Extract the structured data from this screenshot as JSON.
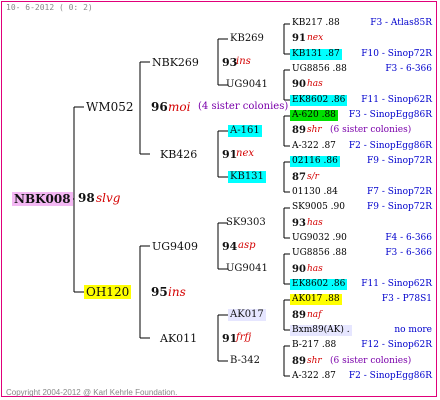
{
  "header": "10-  6-2012 (  0:  2)",
  "footer": "Copyright 2004-2012 @ Karl Kehrle Foundation.",
  "root": {
    "name": "NBK008",
    "num": "98",
    "tag": "slvg"
  },
  "g1": [
    {
      "name": "WM052",
      "num": "96",
      "tag": "moi",
      "note": "(4 sister colonies)"
    },
    {
      "name": "OH120",
      "num": "95",
      "tag": "ins"
    }
  ],
  "g2": [
    {
      "name": "NBK269",
      "num": "93",
      "tag": "ins"
    },
    {
      "name": "KB426",
      "num": "91",
      "tag": "nex"
    },
    {
      "name": "UG9409",
      "num": "94",
      "tag": "asp"
    },
    {
      "name": "AK011",
      "num": "91",
      "tag": "frfj"
    }
  ],
  "g3": [
    {
      "name": "KB269"
    },
    {
      "name": "UG9041"
    },
    {
      "name": "A-161"
    },
    {
      "name": "KB131"
    },
    {
      "name": "SK9303"
    },
    {
      "name": "UG9041"
    },
    {
      "name": "AK017"
    },
    {
      "name": "B-342"
    }
  ],
  "g4": [
    {
      "name": "KB217 .88",
      "right": "F3 - Atlas85R"
    },
    {
      "num": "91",
      "tag": "nex"
    },
    {
      "name": "KB131 .87",
      "right": "F10 - Sinop72R"
    },
    {
      "name": "UG8856 .88",
      "right": "F3 - 6-366"
    },
    {
      "num": "90",
      "tag": "has"
    },
    {
      "name": "EK8602 .86",
      "right": "F11 - Sinop62R"
    },
    {
      "name": "A-620 .88",
      "right": "F3 - SinopEgg86R"
    },
    {
      "num": "89",
      "tag": "shr",
      "note": "(6 sister colonies)"
    },
    {
      "name": "A-322 .87",
      "right": "F2 - SinopEgg86R"
    },
    {
      "name": "02116 .86",
      "right": "F9 - Sinop72R"
    },
    {
      "num": "87",
      "tag": "s/r"
    },
    {
      "name": "01130 .84",
      "right": "F7 - Sinop72R"
    },
    {
      "name": "SK9005 .90",
      "right": "F9 - Sinop72R"
    },
    {
      "num": "93",
      "tag": "has"
    },
    {
      "name": "UG9032 .90",
      "right": "F4 - 6-366"
    },
    {
      "name": "UG8856 .88",
      "right": "F3 - 6-366"
    },
    {
      "num": "90",
      "tag": "has"
    },
    {
      "name": "EK8602 .86",
      "right": "F11 - Sinop62R"
    },
    {
      "name": "AK017 .88",
      "right": "F3 - P78S1"
    },
    {
      "num": "89",
      "tag": "naf"
    },
    {
      "name": "Bxm89(AK) .",
      "right": "no more"
    },
    {
      "name": "B-217 .88",
      "right": "F12 - Sinop62R"
    },
    {
      "num": "89",
      "tag": "shr",
      "note": "(6 sister colonies)"
    },
    {
      "name": "A-322 .87",
      "right": "F2 - SinopEgg86R"
    }
  ]
}
